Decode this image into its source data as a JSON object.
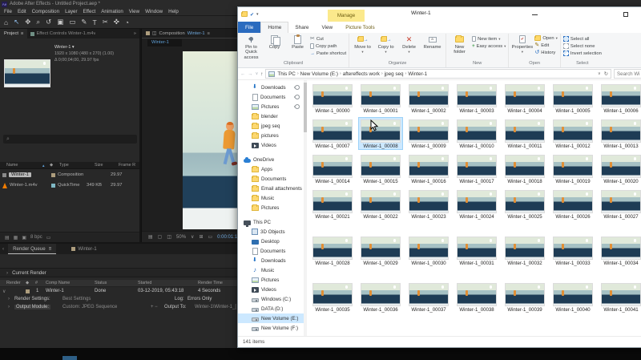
{
  "ae": {
    "title": "Adobe After Effects - Untitled Project.aep *",
    "logo": "Ae",
    "menus": [
      "File",
      "Edit",
      "Composition",
      "Layer",
      "Effect",
      "Animation",
      "View",
      "Window",
      "Help"
    ],
    "tools": [
      "⌂",
      "↖",
      "✥",
      "⌕",
      "↺",
      "▣",
      "▭",
      "✎",
      "T",
      "✂",
      "✜",
      "◔"
    ],
    "project_tab": "Project",
    "effect_controls_tab": "Effect Controls Winter-1.m4v",
    "overflow": "»",
    "comp_tab": "Composition",
    "comp_name": "Winter-1",
    "viewer_tab": "Winter-1",
    "item": {
      "name": "Winter-1 ▾",
      "dims": "1920 x 1080 (480 x 270) (1.00)",
      "duration": "Δ 0;00;04;00, 29.97 fps"
    },
    "cols": {
      "name": "Name",
      "type": "Type",
      "size": "Size",
      "frame": "Frame R"
    },
    "rows": [
      {
        "name": "Winter-1",
        "type": "Composition",
        "size": "",
        "fps": "29.97"
      },
      {
        "name": "Winter-1.m4v",
        "type": "QuickTime",
        "size": "349 KB",
        "fps": "29.97"
      }
    ],
    "depth": "8 bpc",
    "zoom": "50%",
    "timecode": "0:00:01:1",
    "rq": {
      "tab": "Render Queue",
      "comp_tab": "Winter-1",
      "current": "Current Render",
      "h_render": "Render",
      "h_num": "#",
      "h_comp": "Comp Name",
      "h_status": "Status",
      "h_started": "Started",
      "h_time": "Render Time",
      "r_num": "1",
      "r_comp": "Winter-1",
      "r_status": "Done",
      "r_started": "03-12-2019, 05:43:18",
      "r_time": "4 Seconds",
      "rs_label": "Render Settings:",
      "rs_value": "Best Settings",
      "log_label": "Log:",
      "log_value": "Errors Only",
      "om_label": "Output Module:",
      "om_value": "Custom: JPEG Sequence",
      "out_label": "Output To:",
      "out_value": "Winter-1\\Winter-1_["
    }
  },
  "explorer": {
    "title": "Winter-1",
    "manage": "Manage",
    "tab_file": "File",
    "tab_home": "Home",
    "tab_share": "Share",
    "tab_view": "View",
    "tab_pt": "Picture Tools",
    "rb": {
      "pin": "Pin to Quick access",
      "copy": "Copy",
      "paste": "Paste",
      "cut": "Cut",
      "copy_path": "Copy path",
      "paste_shortcut": "Paste shortcut",
      "move_to": "Move to",
      "copy_to": "Copy to",
      "delete": "Delete",
      "rename": "Rename",
      "new_folder": "New folder",
      "new_item": "New item",
      "easy_access": "Easy access",
      "properties": "Properties",
      "open": "Open",
      "edit": "Edit",
      "history": "History",
      "select_all": "Select all",
      "select_none": "Select none",
      "invert": "Invert selection",
      "g_clipboard": "Clipboard",
      "g_organize": "Organize",
      "g_new": "New",
      "g_open": "Open",
      "g_select": "Select"
    },
    "breadcrumb": [
      "This PC",
      "New Volume (E:)",
      "aftereffects work",
      "jpeg seq",
      "Winter-1"
    ],
    "search_placeholder": "Search Wi",
    "nav": [
      {
        "label": "Downloads",
        "icon": "downloads",
        "indent": "2",
        "pinned": "true"
      },
      {
        "label": "Documents",
        "icon": "doc",
        "indent": "2",
        "pinned": "true"
      },
      {
        "label": "Pictures",
        "icon": "pic",
        "indent": "2",
        "pinned": "true"
      },
      {
        "label": "blender",
        "icon": "folder",
        "indent": "2"
      },
      {
        "label": "jpeg seq",
        "icon": "folder",
        "indent": "2"
      },
      {
        "label": "pictures",
        "icon": "folder",
        "indent": "2"
      },
      {
        "label": "Videos",
        "icon": "video",
        "indent": "2"
      },
      {
        "label": "OneDrive",
        "icon": "cloud",
        "indent": "1",
        "gap": "true"
      },
      {
        "label": "Apps",
        "icon": "folder",
        "indent": "2"
      },
      {
        "label": "Documents",
        "icon": "folder",
        "indent": "2"
      },
      {
        "label": "Email attachments",
        "icon": "folder",
        "indent": "2"
      },
      {
        "label": "Music",
        "icon": "folder",
        "indent": "2"
      },
      {
        "label": "Pictures",
        "icon": "folder",
        "indent": "2"
      },
      {
        "label": "This PC",
        "icon": "pc",
        "indent": "1",
        "gap": "true"
      },
      {
        "label": "3D Objects",
        "icon": "cube",
        "indent": "2"
      },
      {
        "label": "Desktop",
        "icon": "desktop",
        "indent": "2"
      },
      {
        "label": "Documents",
        "icon": "doc",
        "indent": "2"
      },
      {
        "label": "Downloads",
        "icon": "downloads",
        "indent": "2"
      },
      {
        "label": "Music",
        "icon": "music",
        "indent": "2"
      },
      {
        "label": "Pictures",
        "icon": "pic",
        "indent": "2"
      },
      {
        "label": "Videos",
        "icon": "video",
        "indent": "2"
      },
      {
        "label": "Windows (C:)",
        "icon": "drive",
        "indent": "2"
      },
      {
        "label": "DATA (D:)",
        "icon": "drive",
        "indent": "2"
      },
      {
        "label": "New Volume (E:)",
        "icon": "drive",
        "indent": "2",
        "selected": "true"
      },
      {
        "label": "New Volume (F:)",
        "icon": "drive",
        "indent": "2"
      }
    ],
    "files": [
      "Winter-1_00000",
      "Winter-1_00001",
      "Winter-1_00002",
      "Winter-1_00003",
      "Winter-1_00004",
      "Winter-1_00005",
      "Winter-1_00006",
      "Winter-1_00007",
      "Winter-1_00008",
      "Winter-1_00009",
      "Winter-1_00010",
      "Winter-1_00011",
      "Winter-1_00012",
      "Winter-1_00013",
      "Winter-1_00014",
      "Winter-1_00015",
      "Winter-1_00016",
      "Winter-1_00017",
      "Winter-1_00018",
      "Winter-1_00019",
      "Winter-1_00020",
      "Winter-1_00021",
      "Winter-1_00022",
      "Winter-1_00023",
      "Winter-1_00024",
      "Winter-1_00025",
      "Winter-1_00026",
      "Winter-1_00027",
      "Winter-1_00028",
      "Winter-1_00029",
      "Winter-1_00030",
      "Winter-1_00031",
      "Winter-1_00032",
      "Winter-1_00033",
      "Winter-1_00034",
      "Winter-1_00035",
      "Winter-1_00036",
      "Winter-1_00037",
      "Winter-1_00038",
      "Winter-1_00039",
      "Winter-1_00040",
      "Winter-1_00041"
    ],
    "files_hover_index": 8,
    "status": "141 items"
  }
}
